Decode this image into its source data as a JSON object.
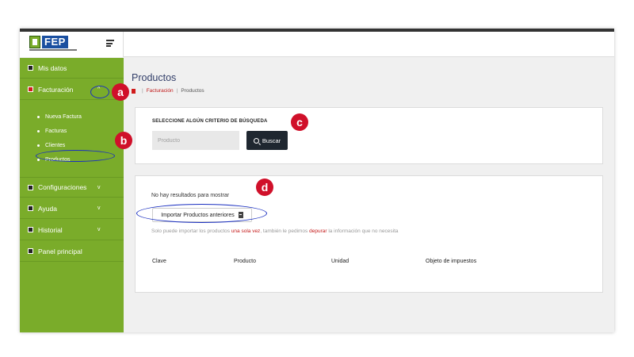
{
  "app": {
    "logo_text": "FEP"
  },
  "sidebar": {
    "items": [
      {
        "label": "Mis datos"
      },
      {
        "label": "Facturación",
        "chevron": "^"
      },
      {
        "label": "Configuraciones",
        "chevron": "v"
      },
      {
        "label": "Ayuda",
        "chevron": "v"
      },
      {
        "label": "Historial",
        "chevron": "v"
      },
      {
        "label": "Panel principal"
      }
    ],
    "subitems": [
      {
        "label": "Nueva Factura"
      },
      {
        "label": "Facturas"
      },
      {
        "label": "Clientes"
      },
      {
        "label": "Productos"
      }
    ]
  },
  "page": {
    "title": "Productos",
    "breadcrumb": {
      "section": "Facturación",
      "current": "Productos",
      "separator": "|"
    }
  },
  "search": {
    "heading": "SELECCIONE ALGÚN CRITERIO DE BÚSQUEDA",
    "placeholder": "Producto",
    "button_label": "Buscar"
  },
  "results": {
    "empty_message": "No hay resultados para mostrar",
    "import_button_label": "Importar Productos anteriores",
    "note": {
      "part1": "Solo puede importar los productos ",
      "hl1": "una sola vez",
      "part2": ", también le pedimos ",
      "hl2": "depurar",
      "part3": " la información que no necesita"
    },
    "columns": [
      "Clave",
      "Producto",
      "Unidad",
      "Objeto de impuestos"
    ]
  },
  "callouts": [
    "a",
    "b",
    "c",
    "d"
  ],
  "colors": {
    "sidebar": "#7aac2a",
    "callout": "#d0102a",
    "ring": "#1a2fc0",
    "button": "#1f2730",
    "accent_red": "#c41a1a"
  }
}
